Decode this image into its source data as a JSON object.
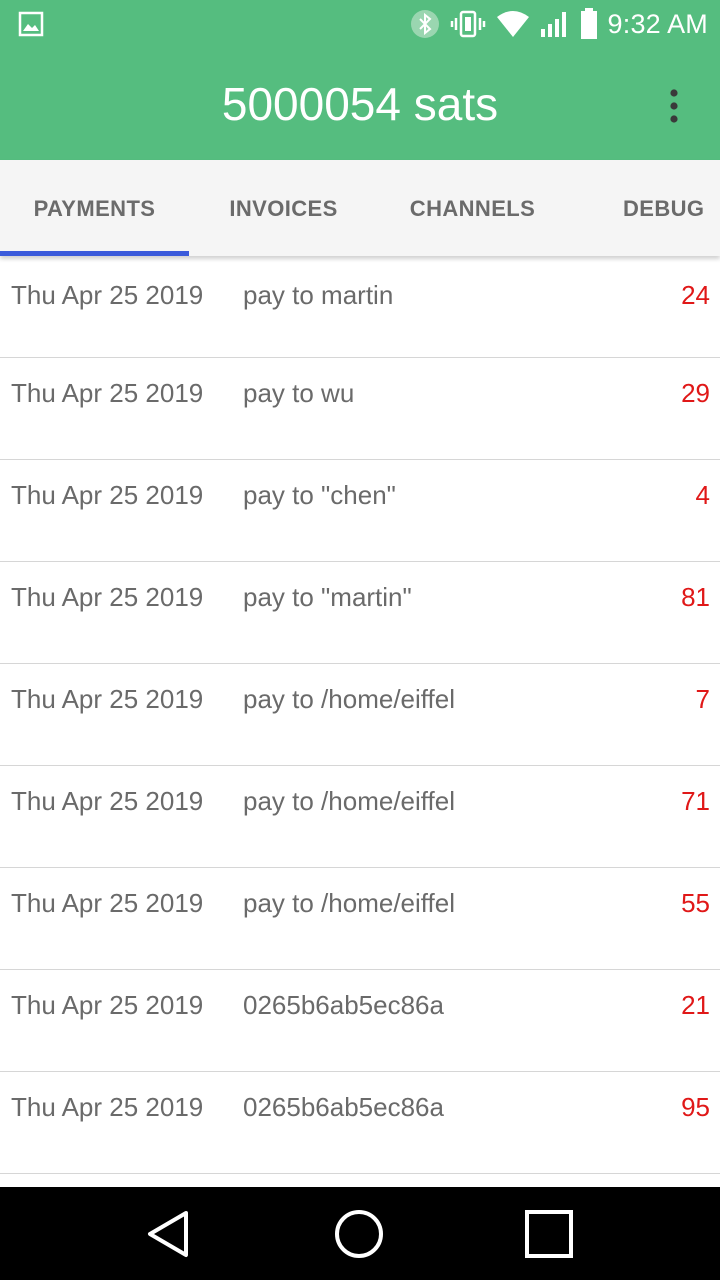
{
  "status_bar": {
    "time": "9:32 AM",
    "icons": [
      "gallery-icon",
      "bluetooth-icon",
      "vibrate-icon",
      "wifi-icon",
      "signal-icon",
      "battery-icon"
    ]
  },
  "app_bar": {
    "title": "5000054 sats",
    "menu_icon": "overflow-menu-icon"
  },
  "tabs": [
    {
      "label": "PAYMENTS",
      "selected": true
    },
    {
      "label": "INVOICES",
      "selected": false
    },
    {
      "label": "CHANNELS",
      "selected": false
    },
    {
      "label": "DEBUG",
      "selected": false
    }
  ],
  "payments": [
    {
      "date": "Thu Apr 25 2019",
      "memo": "pay to martin",
      "amount": "24"
    },
    {
      "date": "Thu Apr 25 2019",
      "memo": "pay to wu",
      "amount": "29"
    },
    {
      "date": "Thu Apr 25 2019",
      "memo": "pay to \"chen\"",
      "amount": "4"
    },
    {
      "date": "Thu Apr 25 2019",
      "memo": "pay to \"martin\"",
      "amount": "81"
    },
    {
      "date": "Thu Apr 25 2019",
      "memo": "pay to /home/eiffel",
      "amount": "7"
    },
    {
      "date": "Thu Apr 25 2019",
      "memo": "pay to /home/eiffel",
      "amount": "71"
    },
    {
      "date": "Thu Apr 25 2019",
      "memo": "pay to /home/eiffel",
      "amount": "55"
    },
    {
      "date": "Thu Apr 25 2019",
      "memo": "0265b6ab5ec86a",
      "amount": "21"
    },
    {
      "date": "Thu Apr 25 2019",
      "memo": "0265b6ab5ec86a",
      "amount": "95"
    }
  ],
  "colors": {
    "primary": "#55bd7f",
    "tab_indicator": "#3b5bdb",
    "amount": "#e01818"
  },
  "nav_bar": {
    "buttons": [
      "back-icon",
      "home-icon",
      "recents-icon"
    ]
  }
}
